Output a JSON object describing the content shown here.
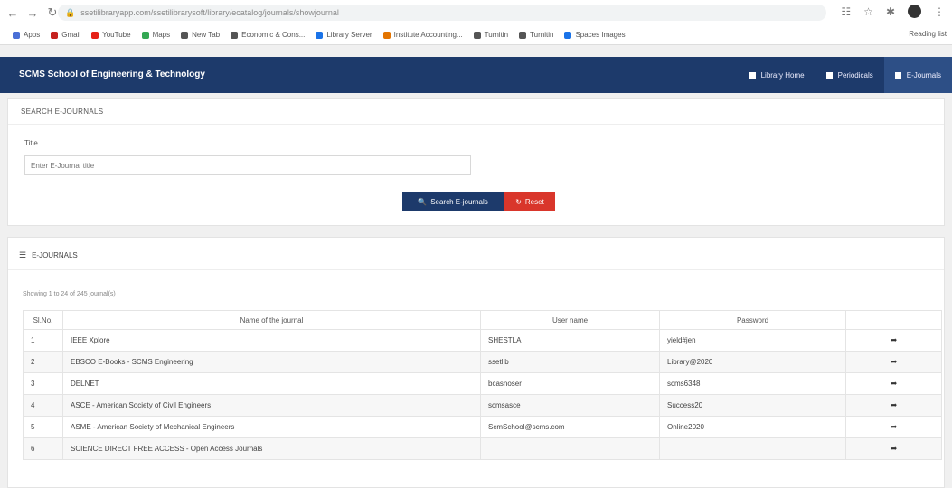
{
  "browser": {
    "url": "ssetilibraryapp.com/ssetilibrarysoft/library/ecatalog/journals/showjournal",
    "bookmarks": [
      {
        "label": "Apps",
        "color": "#4a6fd6"
      },
      {
        "label": "Gmail",
        "color": "#c5221f"
      },
      {
        "label": "YouTube",
        "color": "#e62117"
      },
      {
        "label": "Maps",
        "color": "#34a853"
      },
      {
        "label": "New Tab",
        "color": "#555"
      },
      {
        "label": "Economic & Cons...",
        "color": "#555"
      },
      {
        "label": "Library Server",
        "color": "#1a73e8"
      },
      {
        "label": "Institute Accounting...",
        "color": "#e37400"
      },
      {
        "label": "Turnitin",
        "color": "#555"
      },
      {
        "label": "Turnitin",
        "color": "#555"
      },
      {
        "label": "Spaces Images",
        "color": "#1a73e8"
      }
    ],
    "reading_list": "Reading list"
  },
  "navbar": {
    "brand": "SCMS School of Engineering & Technology",
    "items": [
      {
        "label": "Library Home",
        "active": false
      },
      {
        "label": "Periodicals",
        "active": false
      },
      {
        "label": "E-Journals",
        "active": true
      }
    ]
  },
  "search": {
    "heading": "SEARCH E-JOURNALS",
    "title_label": "Title",
    "title_placeholder": "Enter E-Journal title",
    "search_button": "Search E-journals",
    "reset_button": "Reset"
  },
  "results": {
    "heading": "E-JOURNALS",
    "showing": "Showing 1 to 24 of 245 journal(s)",
    "columns": [
      "Sl.No.",
      "Name of the journal",
      "User name",
      "Password",
      ""
    ],
    "rows": [
      {
        "sno": "1",
        "name": "IEEE Xplore",
        "user": "SHESTLA",
        "pass": "yield#jen"
      },
      {
        "sno": "2",
        "name": "EBSCO E-Books - SCMS Engineering",
        "user": "ssetlib",
        "pass": "Library@2020"
      },
      {
        "sno": "3",
        "name": "DELNET",
        "user": "bcasnoser",
        "pass": "scms6348"
      },
      {
        "sno": "4",
        "name": "ASCE - American Society of Civil Engineers",
        "user": "scmsasce",
        "pass": "Success20"
      },
      {
        "sno": "5",
        "name": "ASME - American Society of Mechanical Engineers",
        "user": "ScmSchool@scms.com",
        "pass": "Online2020"
      },
      {
        "sno": "6",
        "name": "SCIENCE DIRECT FREE ACCESS - Open Access Journals",
        "user": "",
        "pass": ""
      }
    ]
  }
}
